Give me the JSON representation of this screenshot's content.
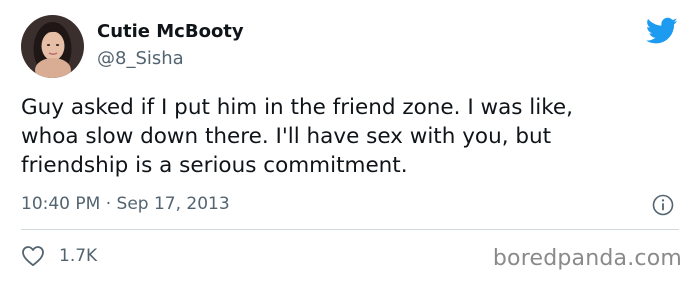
{
  "author": {
    "display_name": "Cutie McBooty",
    "handle": "@8_Sisha",
    "avatar_icon": "profile-photo"
  },
  "tweet": {
    "lines": [
      "Guy asked if I put him in the friend zone. I was like,",
      "whoa slow down there. I'll have sex with you, but",
      "friendship is a serious commitment."
    ],
    "timestamp": "10:40 PM · Sep 17, 2013",
    "likes": "1.7K"
  },
  "icons": {
    "brand": "twitter-bird-icon",
    "info": "info-icon",
    "like": "heart-icon"
  },
  "colors": {
    "brand_blue": "#1d9bf0",
    "secondary_text": "#536471",
    "primary_text": "#0f1419"
  },
  "watermark": "boredpanda.com"
}
